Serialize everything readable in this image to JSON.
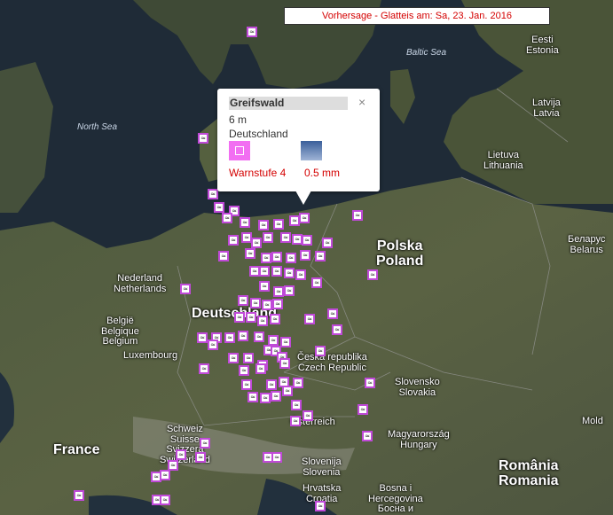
{
  "title": "Vorhersage - Glatteis am: Sa, 23. Jan. 2016",
  "colors": {
    "marker_border": "#c04ad8",
    "warning_text": "#d40000",
    "warn_icon": "#f26ef2"
  },
  "marker_glyph": "≈",
  "map_labels": {
    "north_sea": "North Sea",
    "baltic_sea": "Baltic Sea",
    "estonia": "Eesti\nEstonia",
    "latvia": "Latvija\nLatvia",
    "lithuania": "Lietuva\nLithuania",
    "poland": "Polska\nPoland",
    "belarus": "Беларус\nBelarus",
    "netherlands": "Nederland\nNetherlands",
    "belgium": "België\nBelgique\nBelgium",
    "luxembourg": "Luxembourg",
    "germany": "Deutschland",
    "czech": "Česká republika\nCzech Republic",
    "slovakia": "Slovensko\nSlovakia",
    "austria": "Österreich",
    "hungary": "Magyarország\nHungary",
    "switzerland": "Schweiz\nSuisse\nSvizzera\nSwitzerland",
    "france": "France",
    "slovenia": "Slovenija\nSlovenia",
    "croatia": "Hrvatska\nCroatia",
    "bosnia": "Bosna i\nHercegovina\nБосна и",
    "romania": "România\nRomania",
    "moldova": "Mold"
  },
  "popup": {
    "station": "Greifswald",
    "elevation": "6 m",
    "country": "Deutschland",
    "warning_level": "Warnstufe 4",
    "precipitation": "0.5  mm",
    "close_label": "×",
    "warn_icon": "warning-level-icon",
    "weather_icon": "weather-sky-icon"
  }
}
